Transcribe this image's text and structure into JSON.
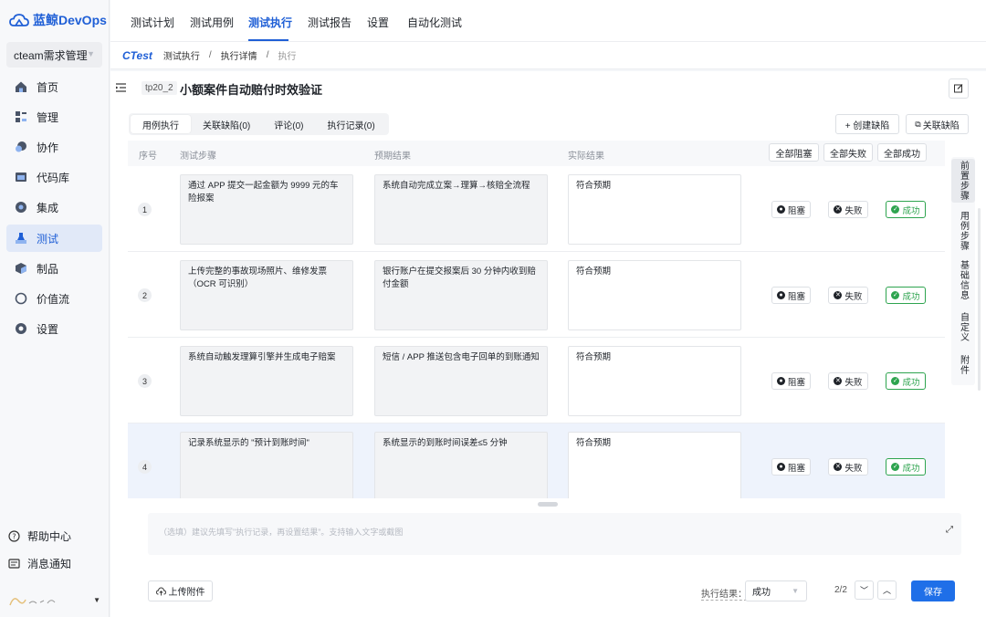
{
  "app": {
    "name": "蓝鲸DevOps",
    "brand_color": "#1f5fd6"
  },
  "project": {
    "name": "cteam需求管理"
  },
  "sidebar": {
    "items": [
      {
        "label": "首页",
        "icon": "home-icon"
      },
      {
        "label": "管理",
        "icon": "manage-icon"
      },
      {
        "label": "协作",
        "icon": "collaborate-icon"
      },
      {
        "label": "代码库",
        "icon": "code-repo-icon"
      },
      {
        "label": "集成",
        "icon": "integration-icon"
      },
      {
        "label": "测试",
        "icon": "test-icon",
        "active": true
      },
      {
        "label": "制品",
        "icon": "artifact-icon"
      },
      {
        "label": "价值流",
        "icon": "value-stream-icon"
      },
      {
        "label": "设置",
        "icon": "settings-icon"
      }
    ],
    "help": "帮助中心",
    "notify": "消息通知"
  },
  "topnav": {
    "tabs": [
      "测试计划",
      "测试用例",
      "测试执行",
      "测试报告",
      "设置",
      "自动化测试"
    ],
    "active": "测试执行"
  },
  "breadcrumb": {
    "brand": "CTest",
    "items": [
      "测试执行",
      "执行详情",
      "执行"
    ]
  },
  "case": {
    "id": "tp20_2",
    "title": "小额案件自动赔付时效验证"
  },
  "subtabs": [
    "用例执行",
    "关联缺陷(0)",
    "评论(0)",
    "执行记录(0)"
  ],
  "actions": {
    "create_defect": "+ 创建缺陷",
    "link_defect": "关联缺陷"
  },
  "table": {
    "headers": {
      "no": "序号",
      "step": "测试步骤",
      "expected": "预期结果",
      "actual": "实际结果"
    },
    "bulk": {
      "block": "全部阻塞",
      "fail": "全部失败",
      "pass": "全部成功"
    },
    "row_actions": {
      "block": "阻塞",
      "fail": "失败",
      "pass": "成功"
    },
    "rows": [
      {
        "no": "1",
        "step": "通过 APP 提交一起金额为 9999 元的车险报案",
        "expected": "系统自动完成立案→理算→核赔全流程",
        "actual": "符合预期"
      },
      {
        "no": "2",
        "step": "上传完整的事故现场照片、维修发票（OCR 可识别）",
        "expected": "银行账户在提交报案后 30 分钟内收到赔付金额",
        "actual": "符合预期"
      },
      {
        "no": "3",
        "step": "系统自动触发理算引擎并生成电子赔案",
        "expected": "短信 / APP 推送包含电子回单的到账通知",
        "actual": "符合预期"
      },
      {
        "no": "4",
        "step": "记录系统显示的 \"预计到账时间\"",
        "expected": "系统显示的到账时间误差≤5 分钟",
        "actual": "符合预期"
      }
    ]
  },
  "side_tabs": [
    "前置步骤",
    "用例步骤",
    "基础信息",
    "自定义",
    "附件"
  ],
  "note": {
    "placeholder": "（选填）建议先填写\"执行记录，再设置结果\"。支持输入文字或截图"
  },
  "footer": {
    "upload": "上传附件",
    "result_label": "执行结果：",
    "result_value": "成功",
    "pager": "2/2",
    "save": "保存"
  },
  "colors": {
    "success": "#2ea44f",
    "primary": "#1f6fe8"
  }
}
